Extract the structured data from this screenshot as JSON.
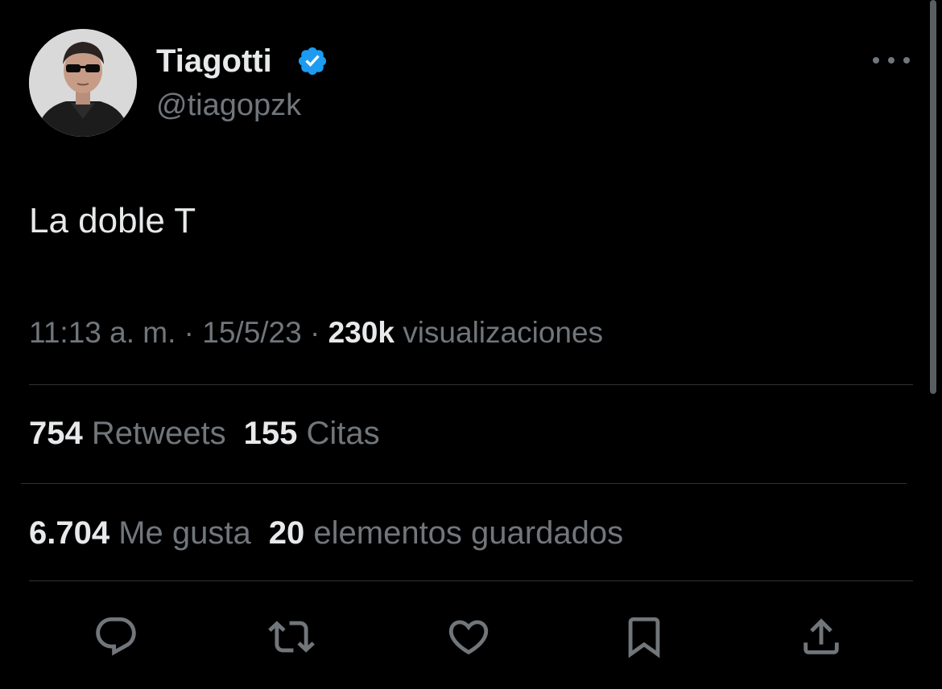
{
  "author": {
    "name": "Tiagotti",
    "handle": "@tiagopzk",
    "verified_color": "#1d9bf0"
  },
  "tweet": {
    "text": "La doble T"
  },
  "meta": {
    "time": "11:13 a. m.",
    "sep1": " · ",
    "date": "15/5/23",
    "sep2": " · ",
    "views_count": "230k",
    "views_label": " visualizaciones"
  },
  "stats": {
    "retweets_count": "754",
    "retweets_label": " Retweets",
    "quotes_count": "155",
    "quotes_label": " Citas",
    "likes_count": "6.704",
    "likes_label": " Me gusta",
    "bookmarks_count": "20",
    "bookmarks_label": " elementos guardados"
  },
  "actions": [
    "reply-icon",
    "retweet-icon",
    "like-icon",
    "bookmark-icon",
    "share-icon"
  ],
  "colors": {
    "background": "#000000",
    "text_primary": "#e7e9ea",
    "text_secondary": "#71767b",
    "divider": "#2f3336"
  }
}
